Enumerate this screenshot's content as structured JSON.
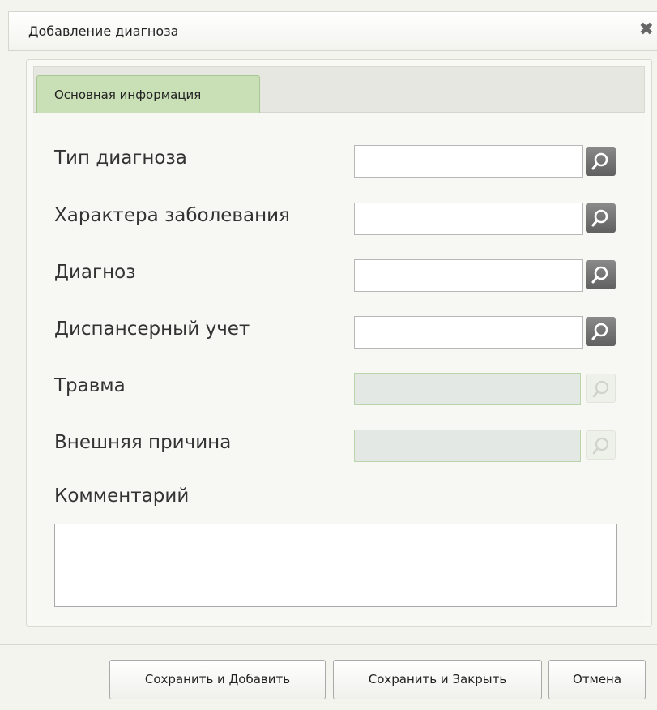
{
  "dialog": {
    "title": "Добавление диагноза",
    "close_icon": "close-icon"
  },
  "tabs": [
    {
      "label": "Основная информация",
      "active": true
    }
  ],
  "form": {
    "fields": [
      {
        "label": "Тип диагноза",
        "value": "",
        "enabled": true
      },
      {
        "label": "Характера заболевания",
        "value": "",
        "enabled": true
      },
      {
        "label": "Диагноз",
        "value": "",
        "enabled": true
      },
      {
        "label": "Диспансерный учет",
        "value": "",
        "enabled": true
      },
      {
        "label": "Травма",
        "value": "",
        "enabled": false
      },
      {
        "label": "Внешняя причина",
        "value": "",
        "enabled": false
      }
    ],
    "comment": {
      "label": "Комментарий",
      "value": ""
    }
  },
  "buttons": {
    "save_add": "Сохранить и Добавить",
    "save_close": "Сохранить и Закрыть",
    "cancel": "Отмена"
  },
  "colors": {
    "tab_active": "#c9dfb6",
    "search_button": "#6e6e6e",
    "disabled_field": "#e3e8e5"
  },
  "icons": {
    "search": "search-icon"
  }
}
